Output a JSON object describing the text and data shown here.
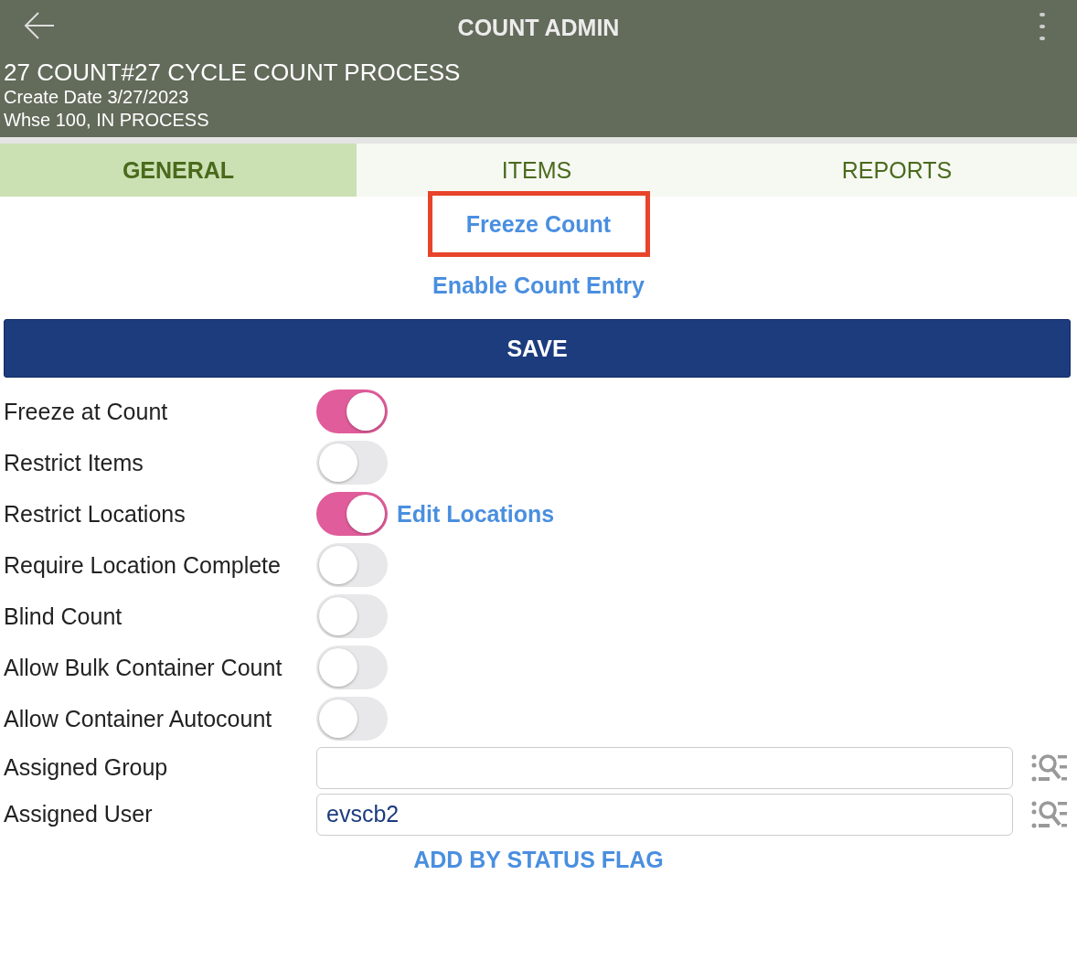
{
  "header": {
    "title": "COUNT ADMIN",
    "heading": "27 COUNT#27 CYCLE COUNT PROCESS",
    "lines": [
      "Create Date 3/27/2023",
      "Whse 100, IN PROCESS"
    ]
  },
  "tabs": [
    {
      "label": "GENERAL",
      "selected": true
    },
    {
      "label": "ITEMS",
      "selected": false
    },
    {
      "label": "REPORTS",
      "selected": false
    }
  ],
  "actions": [
    {
      "label": "Freeze Count",
      "highlighted": true
    },
    {
      "label": "Enable Count Entry",
      "highlighted": false
    }
  ],
  "save_button": "SAVE",
  "settings": [
    {
      "kind": "toggle",
      "label": "Freeze at Count",
      "on": true
    },
    {
      "kind": "toggle",
      "label": "Restrict Items",
      "on": false
    },
    {
      "kind": "toggle",
      "label": "Restrict Locations",
      "on": true,
      "link": "Edit Locations"
    },
    {
      "kind": "toggle",
      "label": "Require Location Complete",
      "on": false
    },
    {
      "kind": "toggle",
      "label": "Blind Count",
      "on": false
    },
    {
      "kind": "toggle",
      "label": "Allow Bulk Container Count",
      "on": false
    },
    {
      "kind": "toggle",
      "label": "Allow Container Autocount",
      "on": false
    },
    {
      "kind": "lookup",
      "label": "Assigned Group"
    },
    {
      "kind": "lookup",
      "label": "Assigned User",
      "value": "evscb2"
    }
  ],
  "footer_link": "ADD BY STATUS FLAG"
}
